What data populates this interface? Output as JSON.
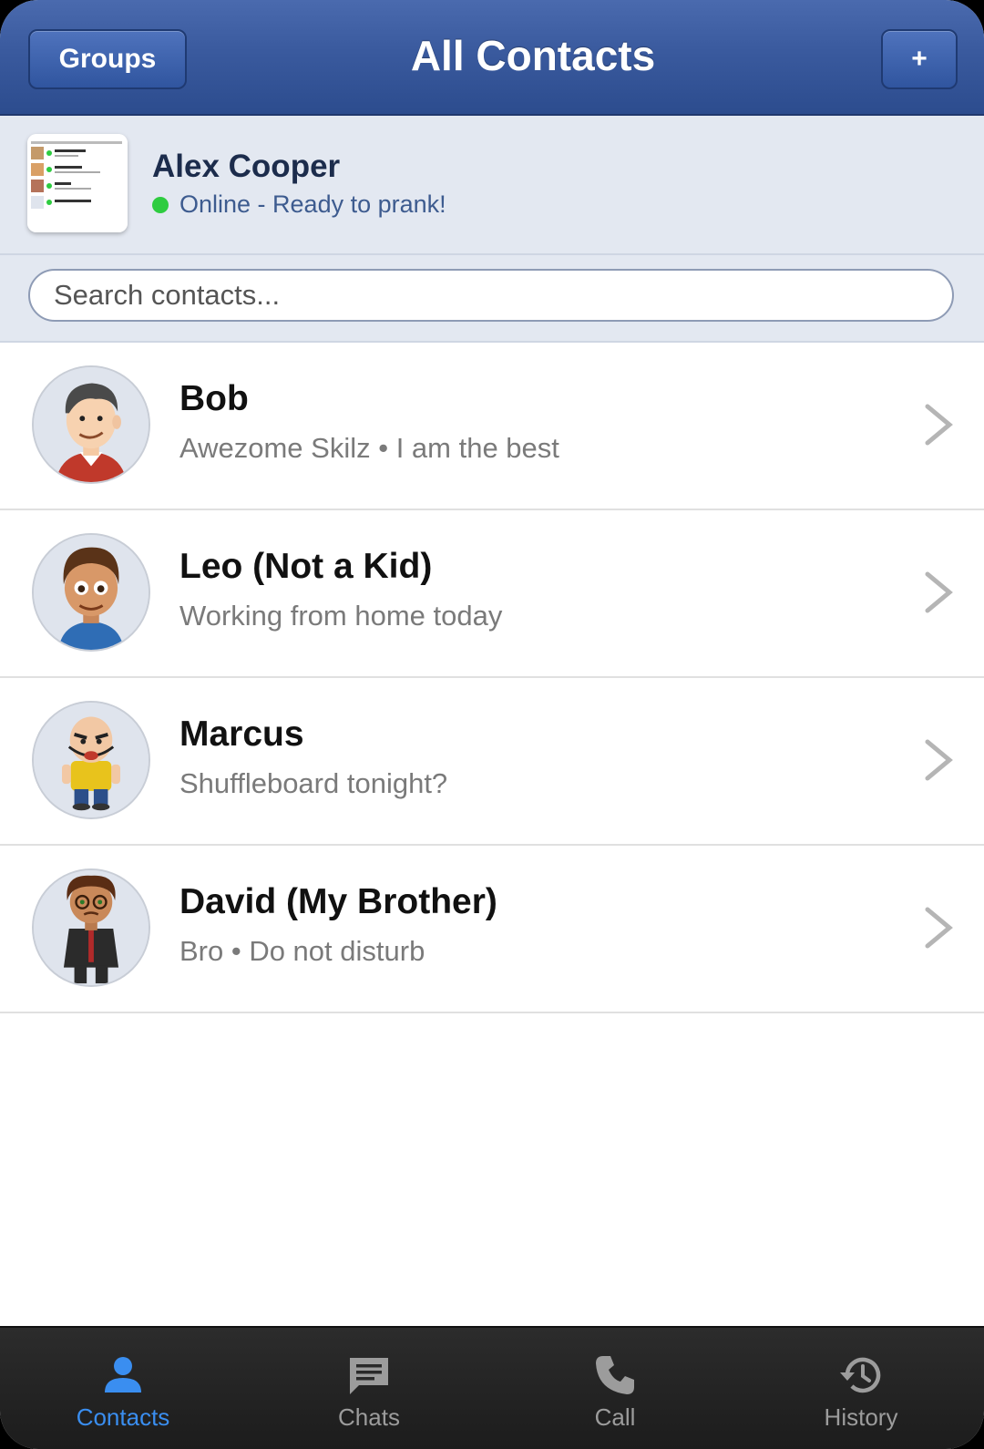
{
  "header": {
    "groups_label": "Groups",
    "title": "All Contacts",
    "add_label": "+"
  },
  "profile": {
    "name": "Alex Cooper",
    "status": "Online - Ready to prank!",
    "status_color": "#2ecc40"
  },
  "search": {
    "placeholder": "Search contacts...",
    "value": ""
  },
  "contacts": [
    {
      "name": "Bob",
      "status": "Awezome Skilz • I am the best",
      "avatar_icon": "cartoon-man-icon"
    },
    {
      "name": "Leo (Not a Kid)",
      "status": "Working from home today",
      "avatar_icon": "cartoon-boy-icon"
    },
    {
      "name": "Marcus",
      "status": "Shuffleboard tonight?",
      "avatar_icon": "cartoon-bald-man-icon"
    },
    {
      "name": "David (My Brother)",
      "status": "Bro • Do not disturb",
      "avatar_icon": "cartoon-man-glasses-icon"
    }
  ],
  "tabs": [
    {
      "label": "Contacts",
      "icon": "person-icon",
      "active": true
    },
    {
      "label": "Chats",
      "icon": "chat-icon",
      "active": false
    },
    {
      "label": "Call",
      "icon": "phone-icon",
      "active": false
    },
    {
      "label": "History",
      "icon": "history-icon",
      "active": false
    }
  ],
  "colors": {
    "header_blue": "#3a5a9e",
    "active_tab": "#3a8ef0",
    "inactive_tab": "#9c9c9c"
  }
}
